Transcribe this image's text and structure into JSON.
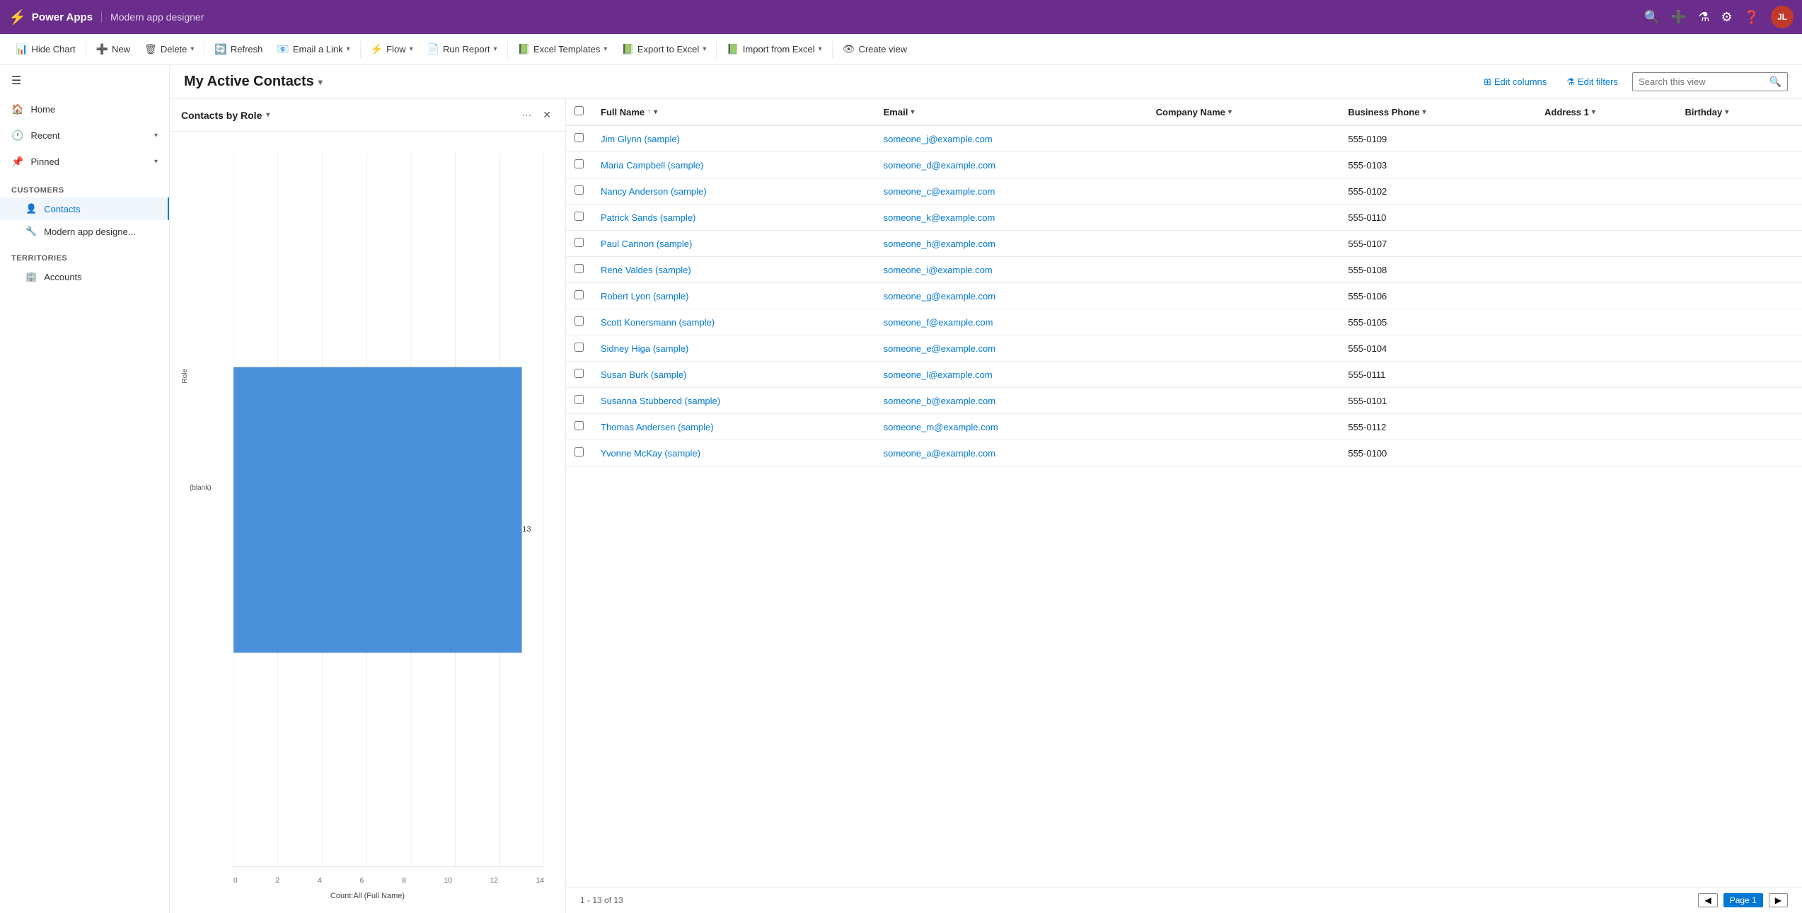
{
  "app": {
    "title": "Power Apps",
    "subtitle": "Modern app designer",
    "avatar_initials": "JL"
  },
  "cmdbar": {
    "hide_chart": "Hide Chart",
    "new": "New",
    "delete": "Delete",
    "refresh": "Refresh",
    "email_link": "Email a Link",
    "flow": "Flow",
    "run_report": "Run Report",
    "excel_templates": "Excel Templates",
    "export_to_excel": "Export to Excel",
    "import_from_excel": "Import from Excel",
    "create_view": "Create view"
  },
  "sidebar": {
    "hamburger": "☰",
    "nav_items": [
      {
        "label": "Home",
        "icon": "🏠",
        "has_chevron": false
      },
      {
        "label": "Recent",
        "icon": "🕐",
        "has_chevron": true
      },
      {
        "label": "Pinned",
        "icon": "📌",
        "has_chevron": true
      }
    ],
    "sections": [
      {
        "label": "Customers",
        "items": [
          {
            "label": "Contacts",
            "icon": "👤",
            "active": true
          },
          {
            "label": "Modern app designe...",
            "icon": "🔧",
            "active": false
          }
        ]
      },
      {
        "label": "Territories",
        "items": [
          {
            "label": "Accounts",
            "icon": "🏢",
            "active": false
          }
        ]
      }
    ]
  },
  "view": {
    "title": "My Active Contacts",
    "edit_columns": "Edit columns",
    "edit_filters": "Edit filters",
    "search_placeholder": "Search this view"
  },
  "chart": {
    "title": "Contacts by Role",
    "bar_value": 13,
    "blank_label": "(blank)",
    "role_label": "Role",
    "x_axis_label": "Count:All (Full Name)",
    "x_ticks": [
      "0",
      "2",
      "4",
      "6",
      "8",
      "10",
      "12",
      "14"
    ]
  },
  "table": {
    "columns": [
      {
        "label": "Full Name",
        "sort": "↑",
        "filter": true
      },
      {
        "label": "Email",
        "sort": "",
        "filter": true
      },
      {
        "label": "Company Name",
        "sort": "",
        "filter": true
      },
      {
        "label": "Business Phone",
        "sort": "",
        "filter": true
      },
      {
        "label": "Address 1",
        "sort": "",
        "filter": true
      },
      {
        "label": "Birthday",
        "sort": "",
        "filter": true
      }
    ],
    "rows": [
      {
        "name": "Jim Glynn (sample)",
        "email": "someone_j@example.com",
        "company": "",
        "phone": "555-0109",
        "address": "",
        "birthday": ""
      },
      {
        "name": "Maria Campbell (sample)",
        "email": "someone_d@example.com",
        "company": "",
        "phone": "555-0103",
        "address": "",
        "birthday": ""
      },
      {
        "name": "Nancy Anderson (sample)",
        "email": "someone_c@example.com",
        "company": "",
        "phone": "555-0102",
        "address": "",
        "birthday": ""
      },
      {
        "name": "Patrick Sands (sample)",
        "email": "someone_k@example.com",
        "company": "",
        "phone": "555-0110",
        "address": "",
        "birthday": ""
      },
      {
        "name": "Paul Cannon (sample)",
        "email": "someone_h@example.com",
        "company": "",
        "phone": "555-0107",
        "address": "",
        "birthday": ""
      },
      {
        "name": "Rene Valdes (sample)",
        "email": "someone_i@example.com",
        "company": "",
        "phone": "555-0108",
        "address": "",
        "birthday": ""
      },
      {
        "name": "Robert Lyon (sample)",
        "email": "someone_g@example.com",
        "company": "",
        "phone": "555-0106",
        "address": "",
        "birthday": ""
      },
      {
        "name": "Scott Konersmann (sample)",
        "email": "someone_f@example.com",
        "company": "",
        "phone": "555-0105",
        "address": "",
        "birthday": ""
      },
      {
        "name": "Sidney Higa (sample)",
        "email": "someone_e@example.com",
        "company": "",
        "phone": "555-0104",
        "address": "",
        "birthday": ""
      },
      {
        "name": "Susan Burk (sample)",
        "email": "someone_l@example.com",
        "company": "",
        "phone": "555-0111",
        "address": "",
        "birthday": ""
      },
      {
        "name": "Susanna Stubberod (sample)",
        "email": "someone_b@example.com",
        "company": "",
        "phone": "555-0101",
        "address": "",
        "birthday": ""
      },
      {
        "name": "Thomas Andersen (sample)",
        "email": "someone_m@example.com",
        "company": "",
        "phone": "555-0112",
        "address": "",
        "birthday": ""
      },
      {
        "name": "Yvonne McKay (sample)",
        "email": "someone_a@example.com",
        "company": "",
        "phone": "555-0100",
        "address": "",
        "birthday": ""
      }
    ],
    "footer": {
      "record_count": "1 - 13 of 13",
      "page_label": "Page 1"
    }
  }
}
